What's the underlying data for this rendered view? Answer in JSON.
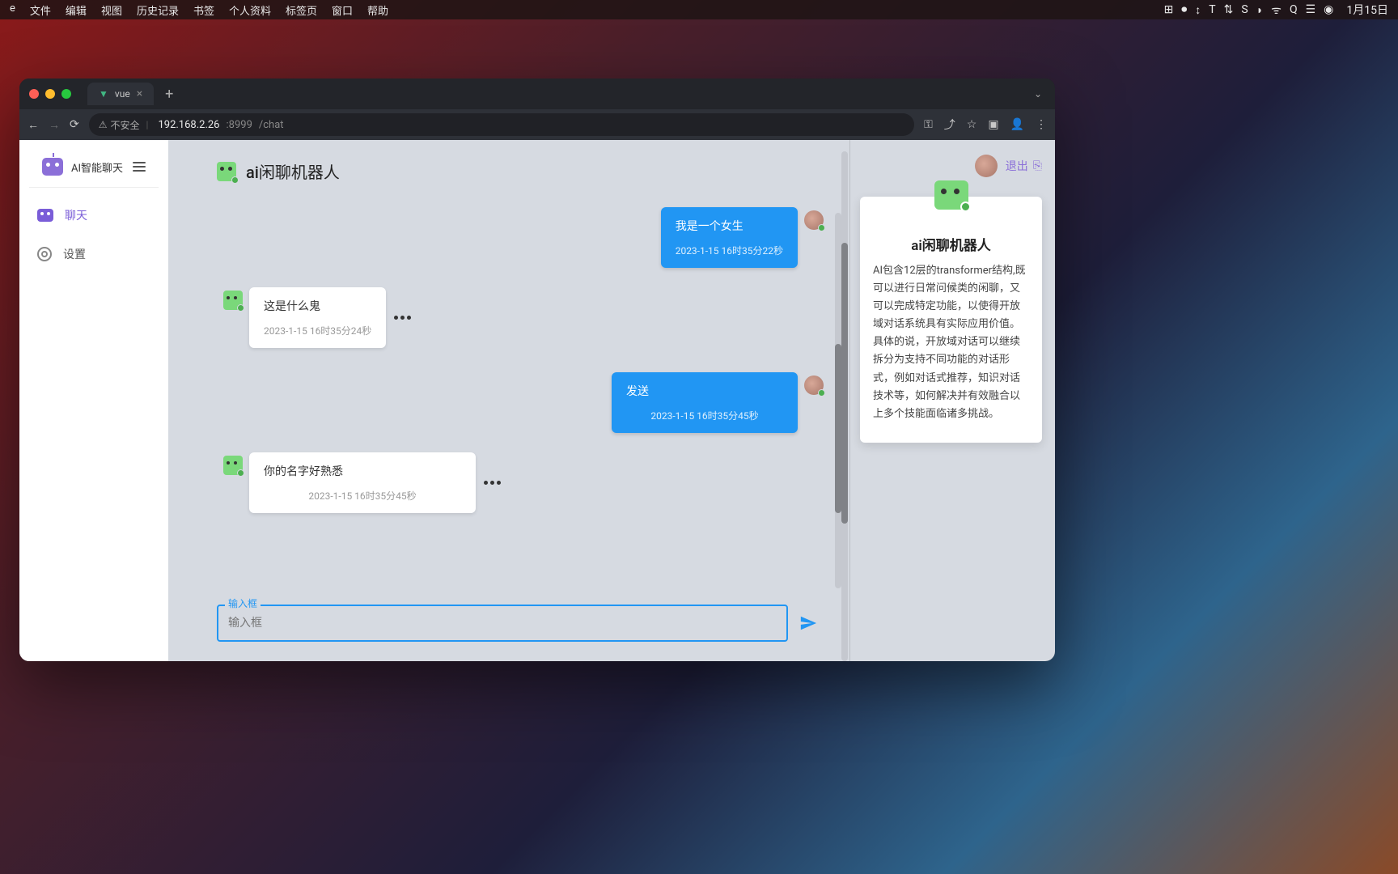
{
  "menubar": {
    "items": [
      "e",
      "文件",
      "编辑",
      "视图",
      "历史记录",
      "书签",
      "个人资料",
      "标签页",
      "窗口",
      "帮助"
    ],
    "date": "1月15日"
  },
  "browser": {
    "tab_title": "vue",
    "url_insecure": "不安全",
    "url_host": "192.168.2.26",
    "url_port": ":8999",
    "url_path": "/chat"
  },
  "sidebar": {
    "title": "AI智能聊天",
    "items": [
      {
        "label": "聊天"
      },
      {
        "label": "设置"
      }
    ]
  },
  "chat": {
    "header_title": "ai闲聊机器人",
    "input_label": "输入框",
    "messages": [
      {
        "side": "right",
        "text": "我是一个女生",
        "ts": "2023-1-15 16时35分22秒"
      },
      {
        "side": "left",
        "text": "这是什么鬼",
        "ts": "2023-1-15 16时35分24秒"
      },
      {
        "side": "right",
        "text": "发送",
        "ts": "2023-1-15 16时35分45秒"
      },
      {
        "side": "left",
        "text": "你的名字好熟悉",
        "ts": "2023-1-15 16时35分45秒"
      }
    ]
  },
  "right_panel": {
    "logout_label": "退出",
    "card_title": "ai闲聊机器人",
    "card_body": "AI包含12层的transformer结构,既可以进行日常问候类的闲聊，又可以完成特定功能，以使得开放域对话系统具有实际应用价值。具体的说，开放域对话可以继续拆分为支持不同功能的对话形式，例如对话式推荐，知识对话技术等，如何解决并有效融合以上多个技能面临诸多挑战。"
  }
}
